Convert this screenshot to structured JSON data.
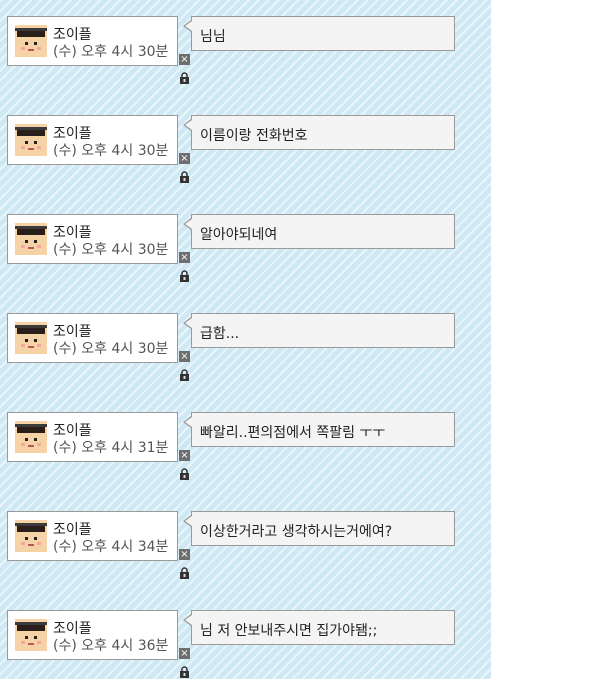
{
  "icons": {
    "avatar": "pixel-avatar-icon",
    "delete": "close-icon",
    "lock": "lock-icon"
  },
  "colors": {
    "board": "#cfe9f4",
    "bubble": "#f4f4f4",
    "border": "#9a9a9a"
  },
  "messages": [
    {
      "author": "조이플",
      "time": "(수) 오후 4시 30분",
      "text": "님님",
      "delete": "×"
    },
    {
      "author": "조이플",
      "time": "(수) 오후 4시 30분",
      "text": "이름이랑 전화번호",
      "delete": "×"
    },
    {
      "author": "조이플",
      "time": "(수) 오후 4시 30분",
      "text": "알아야되네여",
      "delete": "×"
    },
    {
      "author": "조이플",
      "time": "(수) 오후 4시 30분",
      "text": "급함...",
      "delete": "×"
    },
    {
      "author": "조이플",
      "time": "(수) 오후 4시 31분",
      "text": "빠알리..편의점에서 쪽팔림 ㅜㅜ",
      "delete": "×"
    },
    {
      "author": "조이플",
      "time": "(수) 오후 4시 34분",
      "text": "이상한거라고 생각하시는거에여?",
      "delete": "×"
    },
    {
      "author": "조이플",
      "time": "(수) 오후 4시 36분",
      "text": "님 저 안보내주시면 집가야됌;;",
      "delete": "×"
    }
  ]
}
